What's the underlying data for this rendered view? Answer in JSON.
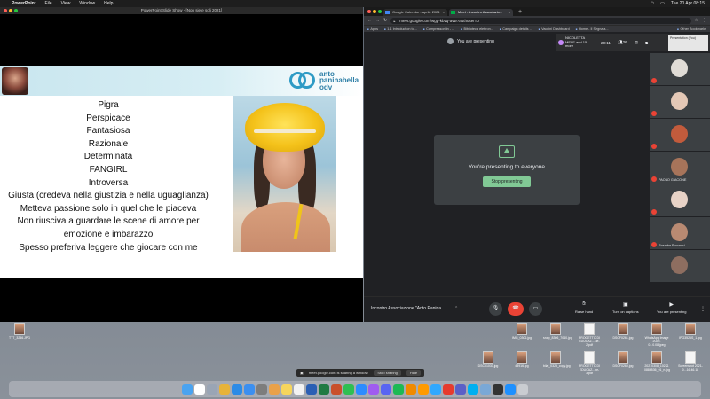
{
  "menubar": {
    "app": "PowerPoint",
    "items": [
      "File",
      "View",
      "Window",
      "Help"
    ],
    "clock": "Tue 20 Apr  08:15"
  },
  "ppt": {
    "window_title": "PowerPoint Slide Show - [Non siete soli 2021]",
    "logo_lines": [
      "anto",
      "paninabella",
      "odv"
    ],
    "traits": [
      "Pigra",
      "Perspicace",
      "Fantasiosa",
      "Razionale",
      "Determinata",
      "FANGIRL",
      "Introversa",
      "Giusta (credeva nella giustizia e nella uguaglianza)",
      "Metteva passione solo in quel che le piaceva",
      "Non riusciva a guardare le scene di amore per emozione e imbarazzo",
      "Spesso preferiva leggere che giocare con me"
    ]
  },
  "chrome": {
    "tabs": [
      {
        "label": "Google Calendar - aprile 2021",
        "favicon_color": "#4285f4"
      },
      {
        "label": "Meet - Incontro Associazio...",
        "favicon_color": "#00ac47"
      }
    ],
    "url": "meet.google.com/wgp-kbvq-avw?authuser=0",
    "bookmarks": [
      "Apps",
      "1.1 Introduction to...",
      "Compressori in - ...",
      "Biblioteca elettron...",
      "Campaign details ...",
      "Vaccini Dashboard",
      "Home - Il Segnala...",
      "Other Bookmarks"
    ]
  },
  "meet": {
    "presenting_label": "You are presenting",
    "people_text": "NICOLETTA MELE and 15 more",
    "people_count": "26",
    "clock": "20:11",
    "self_label": "Presentation (You)",
    "share_message": "You're presenting to everyone",
    "stop_button": "Stop presenting",
    "tiles": [
      {
        "name": "",
        "color": "#e0dcd6"
      },
      {
        "name": "",
        "color": "#e4c8b6"
      },
      {
        "name": "",
        "color": "#c25b3c"
      },
      {
        "name": "",
        "color": "#a7745a"
      },
      {
        "name": "PAOLO GIACONE",
        "color": "#5b4c44"
      },
      {
        "name": "",
        "color": "#e7d2c6"
      },
      {
        "name": "Rosalba Procacci",
        "color": "#b98a72"
      },
      {
        "name": "",
        "color": "#8e6e60"
      }
    ],
    "meeting_title": "Incontro Associazione \"Anto Panina...",
    "actions": {
      "raise_hand": "Raise hand",
      "captions": "Turn on captions",
      "presenting": "You are presenting"
    }
  },
  "desktop": {
    "icons": [
      "TTT_3246.JPG",
      "IMG_0306.jpg",
      "snap_8306_7040.jpg",
      "PROGETTO DI EDUCAZ....ne-2.pdf",
      "DSCF0261.jpg",
      "WhatsApp Image 2020-0...0.08.jpeg",
      "IPG3526S_1.jpg",
      "DSC01033.jpg",
      "43916.jpg",
      "bilal_0325_copy.jpg",
      "PROGETTO DI EDUCAZ...ne-3.pdf",
      "DSCF0260.jpg",
      "20210308_10221 0886536_01_n.jpg",
      "Screenshot 2021-0...16.46.18"
    ],
    "share_note": "meet.google.com is sharing a window.",
    "share_stop": "Stop sharing",
    "share_hide": "Hide"
  },
  "dock": {
    "apps": [
      {
        "name": "finder",
        "color": "#4aa3f0"
      },
      {
        "name": "calendar",
        "color": "#ffffff"
      },
      {
        "name": "launchpad",
        "color": "#9aa5b5"
      },
      {
        "name": "chrome",
        "color": "#e7b33a"
      },
      {
        "name": "safari",
        "color": "#2c8be6"
      },
      {
        "name": "mail",
        "color": "#3b8ff0"
      },
      {
        "name": "system-prefs",
        "color": "#7d7d7d"
      },
      {
        "name": "photos",
        "color": "#e9a14a"
      },
      {
        "name": "notes",
        "color": "#f6d55c"
      },
      {
        "name": "reminders",
        "color": "#f2f2f2"
      },
      {
        "name": "word",
        "color": "#2b5fb4"
      },
      {
        "name": "excel",
        "color": "#1f7a43"
      },
      {
        "name": "powerpoint",
        "color": "#c9502c"
      },
      {
        "name": "whatsapp",
        "color": "#2fbf52"
      },
      {
        "name": "zoom",
        "color": "#2d8cff"
      },
      {
        "name": "messenger",
        "color": "#a05cf0"
      },
      {
        "name": "discord",
        "color": "#5865f2"
      },
      {
        "name": "spotify-like",
        "color": "#1db954"
      },
      {
        "name": "vlc",
        "color": "#f08a00"
      },
      {
        "name": "illustrator",
        "color": "#ff9a00"
      },
      {
        "name": "photoshop",
        "color": "#31a8ff"
      },
      {
        "name": "acrobat",
        "color": "#e63b2e"
      },
      {
        "name": "teams",
        "color": "#5b5fc7"
      },
      {
        "name": "skype",
        "color": "#00aff0"
      },
      {
        "name": "preview",
        "color": "#7aa8d6"
      },
      {
        "name": "terminal",
        "color": "#333333"
      },
      {
        "name": "app-store",
        "color": "#1e90ff"
      },
      {
        "name": "trash",
        "color": "#c9ccd1"
      }
    ]
  }
}
